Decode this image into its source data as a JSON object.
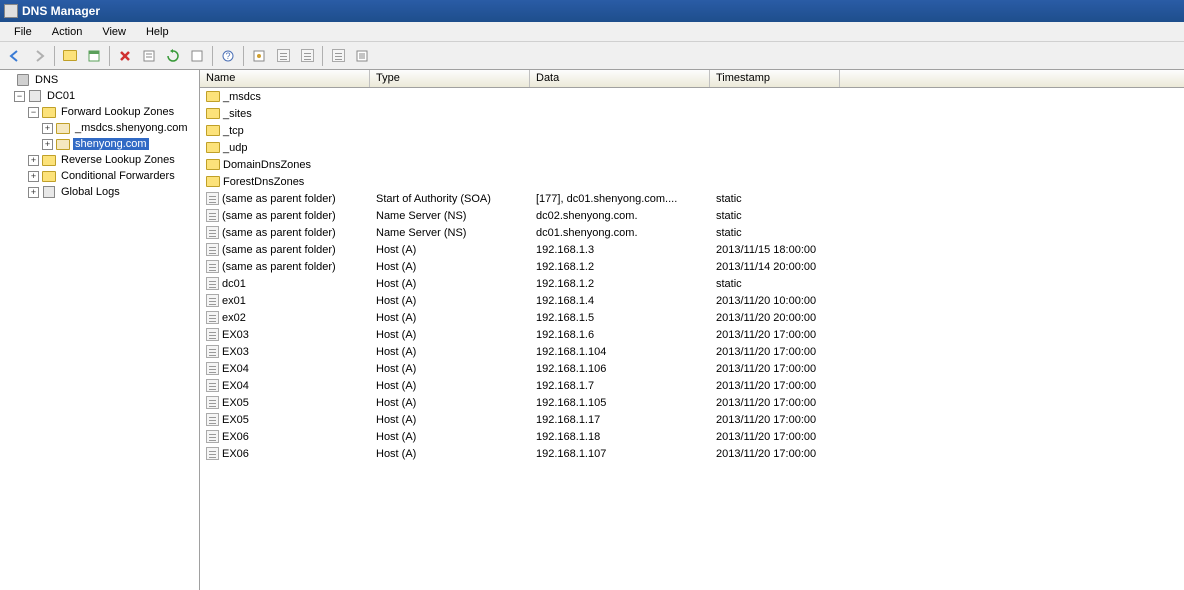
{
  "titlebar": {
    "title": "DNS Manager"
  },
  "menubar": [
    "File",
    "Action",
    "View",
    "Help"
  ],
  "tree": {
    "root": "DNS",
    "server": "DC01",
    "fwd": "Forward Lookup Zones",
    "fwd_items": [
      "_msdcs.shenyong.com",
      "shenyong.com"
    ],
    "rev": "Reverse Lookup Zones",
    "cond": "Conditional Forwarders",
    "glog": "Global Logs",
    "selected": "shenyong.com"
  },
  "columns": [
    "Name",
    "Type",
    "Data",
    "Timestamp"
  ],
  "records": [
    {
      "name": "_msdcs",
      "type": "",
      "data": "",
      "ts": "",
      "icon": "folder"
    },
    {
      "name": "_sites",
      "type": "",
      "data": "",
      "ts": "",
      "icon": "folder"
    },
    {
      "name": "_tcp",
      "type": "",
      "data": "",
      "ts": "",
      "icon": "folder"
    },
    {
      "name": "_udp",
      "type": "",
      "data": "",
      "ts": "",
      "icon": "folder"
    },
    {
      "name": "DomainDnsZones",
      "type": "",
      "data": "",
      "ts": "",
      "icon": "folder"
    },
    {
      "name": "ForestDnsZones",
      "type": "",
      "data": "",
      "ts": "",
      "icon": "folder"
    },
    {
      "name": "(same as parent folder)",
      "type": "Start of Authority (SOA)",
      "data": "[177], dc01.shenyong.com....",
      "ts": "static",
      "icon": "rec"
    },
    {
      "name": "(same as parent folder)",
      "type": "Name Server (NS)",
      "data": "dc02.shenyong.com.",
      "ts": "static",
      "icon": "rec"
    },
    {
      "name": "(same as parent folder)",
      "type": "Name Server (NS)",
      "data": "dc01.shenyong.com.",
      "ts": "static",
      "icon": "rec"
    },
    {
      "name": "(same as parent folder)",
      "type": "Host (A)",
      "data": "192.168.1.3",
      "ts": "2013/11/15 18:00:00",
      "icon": "rec"
    },
    {
      "name": "(same as parent folder)",
      "type": "Host (A)",
      "data": "192.168.1.2",
      "ts": "2013/11/14 20:00:00",
      "icon": "rec"
    },
    {
      "name": "dc01",
      "type": "Host (A)",
      "data": "192.168.1.2",
      "ts": "static",
      "icon": "rec"
    },
    {
      "name": "ex01",
      "type": "Host (A)",
      "data": "192.168.1.4",
      "ts": "2013/11/20 10:00:00",
      "icon": "rec"
    },
    {
      "name": "ex02",
      "type": "Host (A)",
      "data": "192.168.1.5",
      "ts": "2013/11/20 20:00:00",
      "icon": "rec"
    },
    {
      "name": "EX03",
      "type": "Host (A)",
      "data": "192.168.1.6",
      "ts": "2013/11/20 17:00:00",
      "icon": "rec"
    },
    {
      "name": "EX03",
      "type": "Host (A)",
      "data": "192.168.1.104",
      "ts": "2013/11/20 17:00:00",
      "icon": "rec"
    },
    {
      "name": "EX04",
      "type": "Host (A)",
      "data": "192.168.1.106",
      "ts": "2013/11/20 17:00:00",
      "icon": "rec"
    },
    {
      "name": "EX04",
      "type": "Host (A)",
      "data": "192.168.1.7",
      "ts": "2013/11/20 17:00:00",
      "icon": "rec"
    },
    {
      "name": "EX05",
      "type": "Host (A)",
      "data": "192.168.1.105",
      "ts": "2013/11/20 17:00:00",
      "icon": "rec"
    },
    {
      "name": "EX05",
      "type": "Host (A)",
      "data": "192.168.1.17",
      "ts": "2013/11/20 17:00:00",
      "icon": "rec"
    },
    {
      "name": "EX06",
      "type": "Host (A)",
      "data": "192.168.1.18",
      "ts": "2013/11/20 17:00:00",
      "icon": "rec"
    },
    {
      "name": "EX06",
      "type": "Host (A)",
      "data": "192.168.1.107",
      "ts": "2013/11/20 17:00:00",
      "icon": "rec"
    }
  ]
}
